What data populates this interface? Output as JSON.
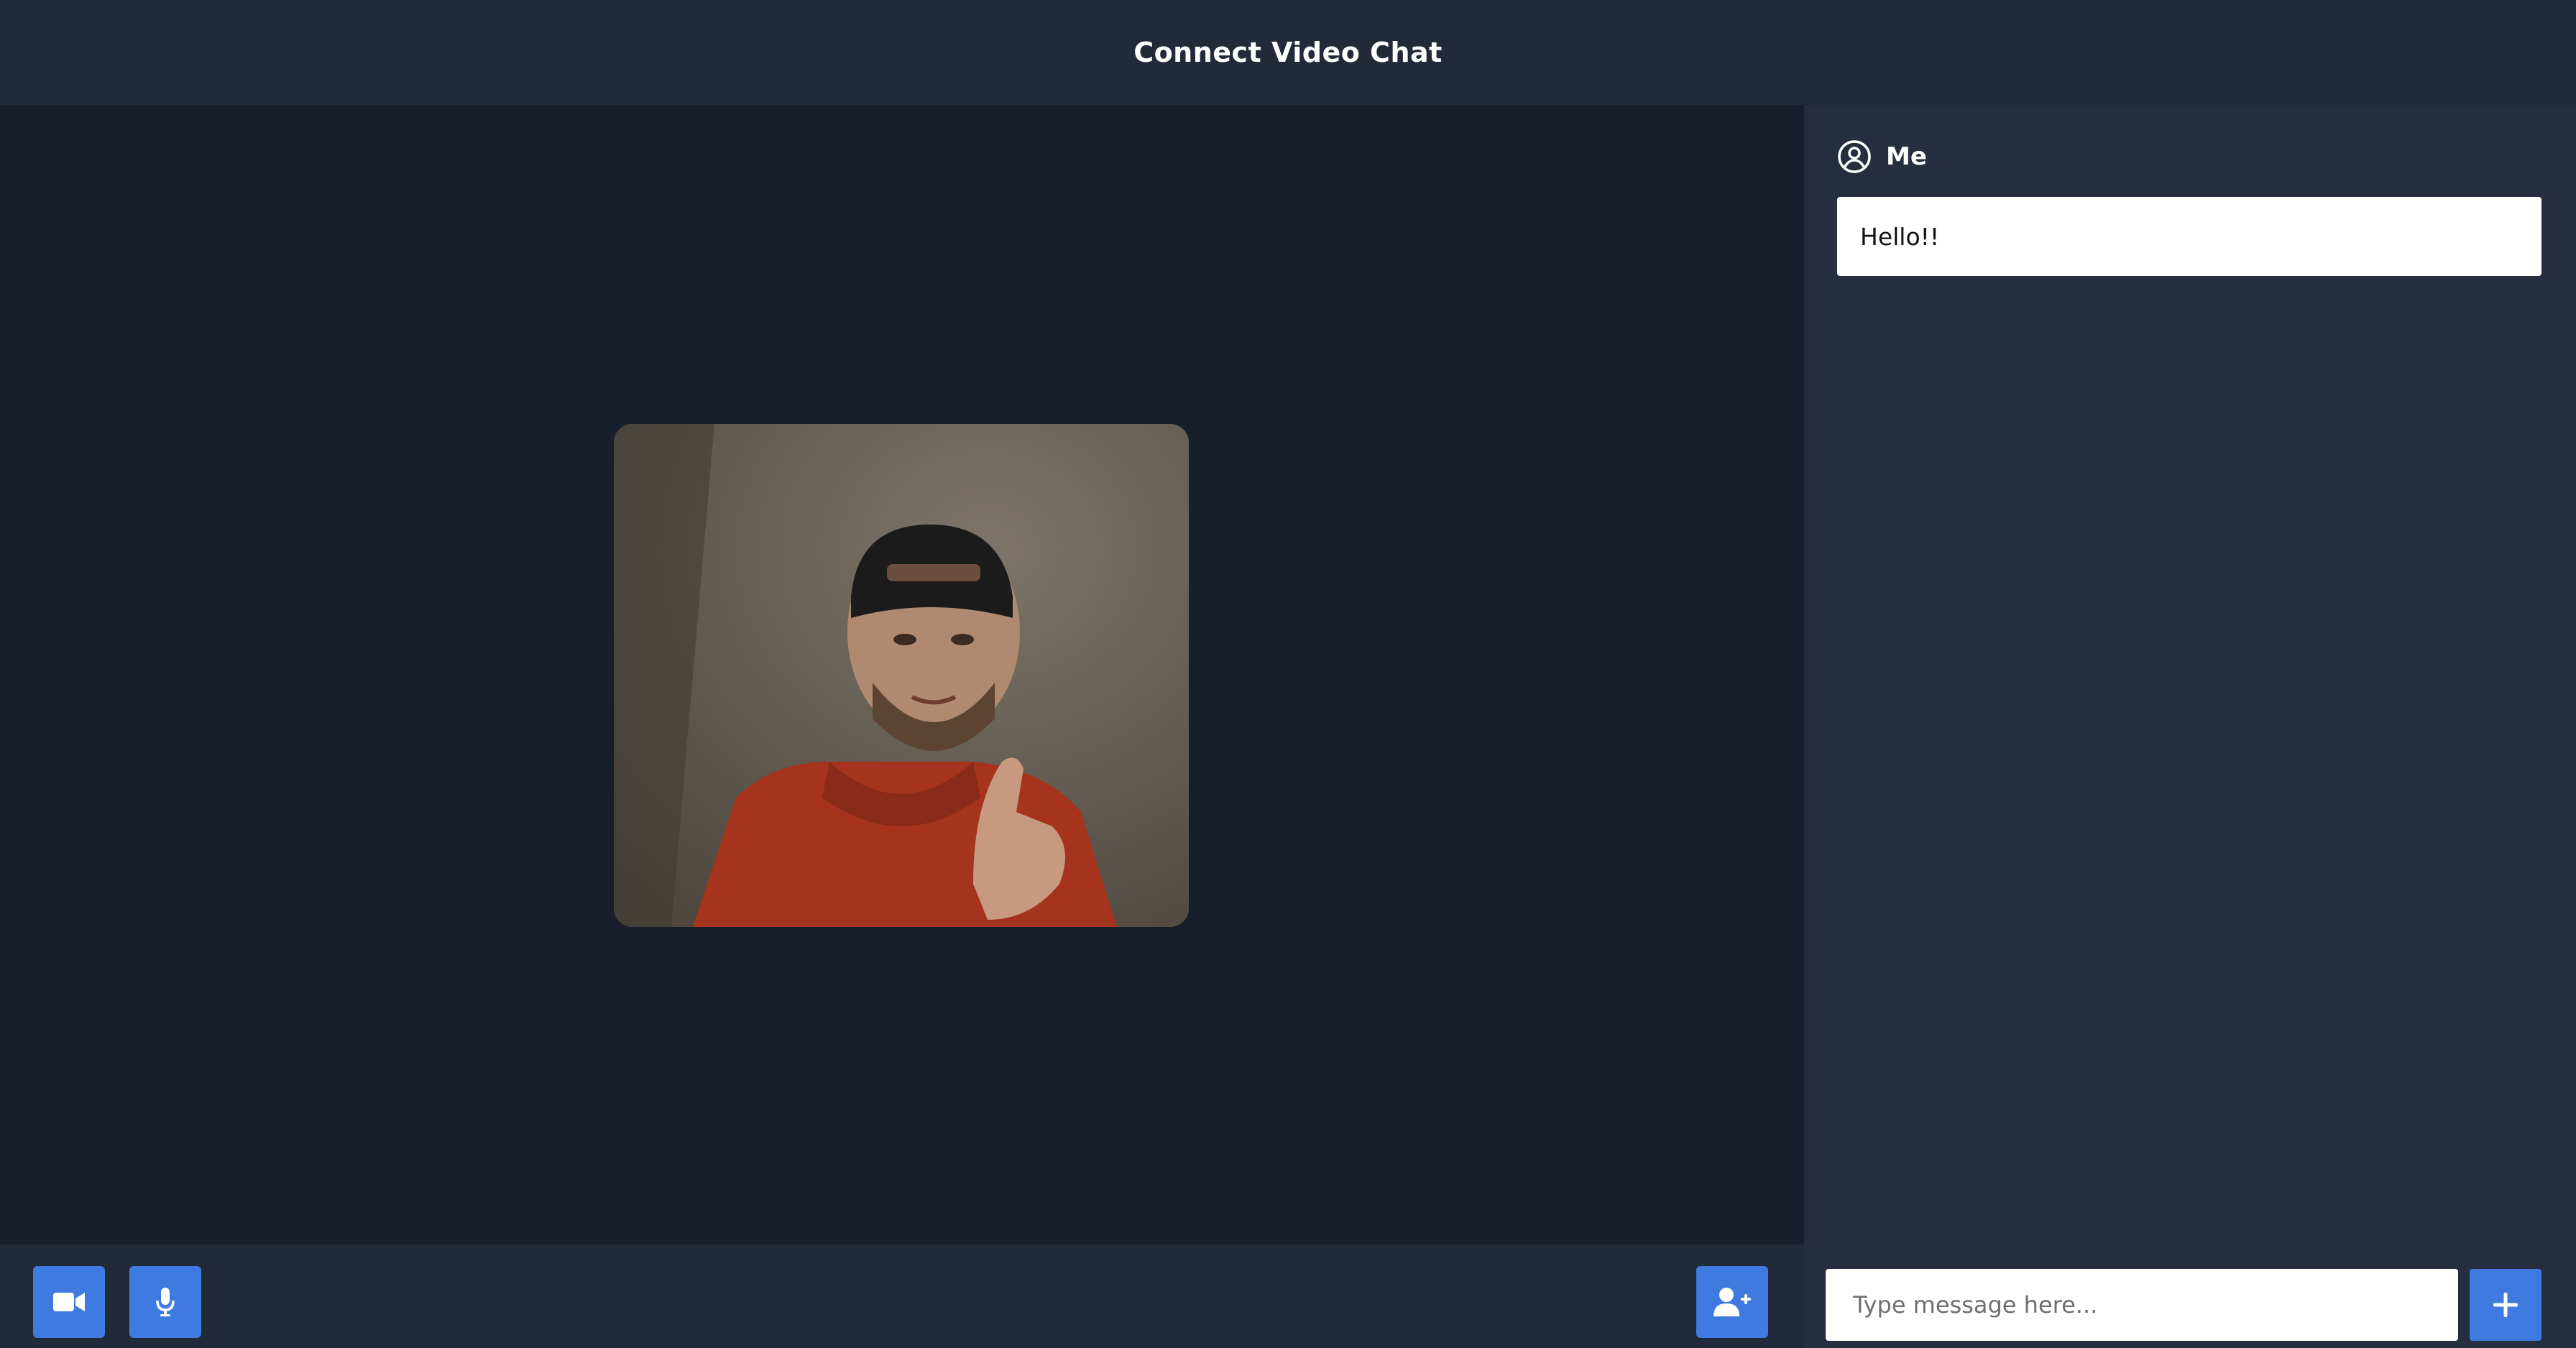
{
  "header": {
    "title": "Connect Video Chat"
  },
  "video": {
    "tile_icon": "participant-video-feed"
  },
  "controls": {
    "camera_icon": "video-camera-icon",
    "mic_icon": "microphone-icon",
    "invite_icon": "add-user-icon"
  },
  "chat": {
    "messages": [
      {
        "sender": "Me",
        "text": "Hello!!"
      }
    ],
    "input": {
      "value": "",
      "placeholder": "Type message here..."
    },
    "send_icon": "plus-icon"
  },
  "colors": {
    "header_bg": "#222a3a",
    "main_bg": "#181e2b",
    "panel_bg": "#252d3e",
    "accent": "#3f7ae0"
  }
}
